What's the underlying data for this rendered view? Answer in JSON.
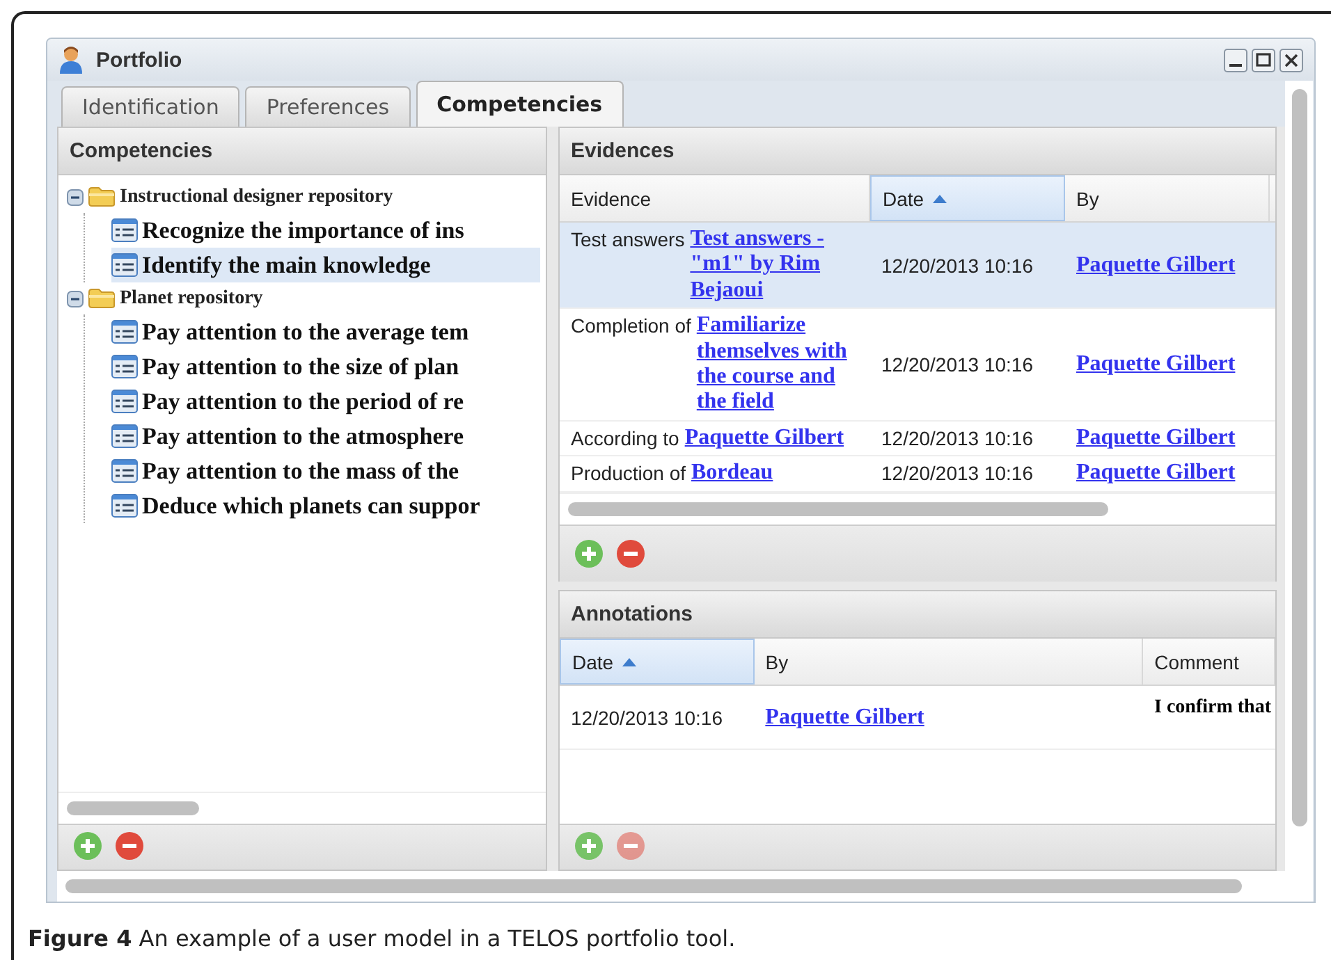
{
  "window": {
    "title": "Portfolio"
  },
  "tabs": [
    {
      "label": "Identification",
      "selected": false
    },
    {
      "label": "Preferences",
      "selected": false
    },
    {
      "label": "Competencies",
      "selected": true
    }
  ],
  "competencies": {
    "title": "Competencies",
    "tree": [
      {
        "label": "Instructional designer repository",
        "expanded": true,
        "children": [
          {
            "label": "Recognize the importance of ins",
            "selected": false
          },
          {
            "label": "Identify the main knowledge",
            "selected": true
          }
        ]
      },
      {
        "label": "Planet repository",
        "expanded": true,
        "children": [
          {
            "label": "Pay attention to the average tem",
            "selected": false
          },
          {
            "label": "Pay attention to the size of plan",
            "selected": false
          },
          {
            "label": "Pay attention to the period of re",
            "selected": false
          },
          {
            "label": "Pay attention to the atmosphere",
            "selected": false
          },
          {
            "label": "Pay attention to the mass of the",
            "selected": false
          },
          {
            "label": "Deduce which planets can suppor",
            "selected": false
          }
        ]
      }
    ]
  },
  "evidences": {
    "title": "Evidences",
    "columns": [
      {
        "label": "Evidence",
        "sorted": false
      },
      {
        "label": "Date",
        "sorted": true
      },
      {
        "label": "By",
        "sorted": false
      }
    ],
    "rows": [
      {
        "prefix": "Test answers",
        "link": "Test answers - \"m1\" by Rim Bejaoui",
        "date": "12/20/2013 10:16",
        "by": "Paquette Gilbert",
        "selected": true
      },
      {
        "prefix": "Completion of",
        "link": "Familiarize themselves with the course and the field",
        "date": "12/20/2013 10:16",
        "by": "Paquette Gilbert",
        "selected": false
      },
      {
        "prefix": "According to",
        "link": "Paquette Gilbert",
        "date": "12/20/2013 10:16",
        "by": "Paquette Gilbert",
        "selected": false
      },
      {
        "prefix": "Production of",
        "link": "Bordeau",
        "date": "12/20/2013 10:16",
        "by": "Paquette Gilbert",
        "selected": false
      }
    ]
  },
  "annotations": {
    "title": "Annotations",
    "columns": [
      {
        "label": "Date",
        "sorted": true
      },
      {
        "label": "By",
        "sorted": false
      },
      {
        "label": "Comment",
        "sorted": false
      }
    ],
    "rows": [
      {
        "date": "12/20/2013 10:16",
        "by": "Paquette Gilbert",
        "comment": "I confirm that"
      }
    ]
  },
  "caption": "**Figure 4** An example of a user model in a TELOS portfolio tool."
}
